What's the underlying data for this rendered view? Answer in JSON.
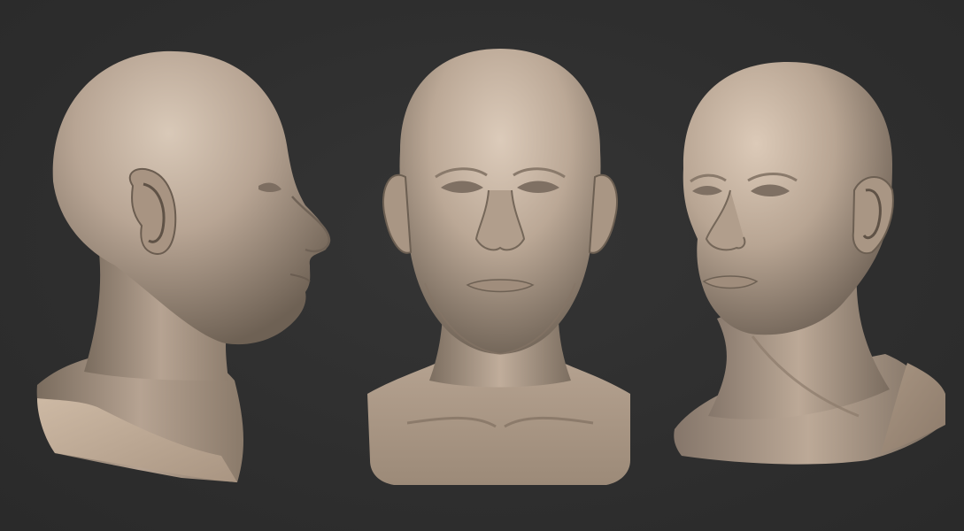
{
  "scene": {
    "background_color": "#2f2f2f",
    "material_color": "#b9a796",
    "views": [
      {
        "view": "left-profile"
      },
      {
        "view": "front"
      },
      {
        "view": "three-quarter-left"
      }
    ]
  }
}
